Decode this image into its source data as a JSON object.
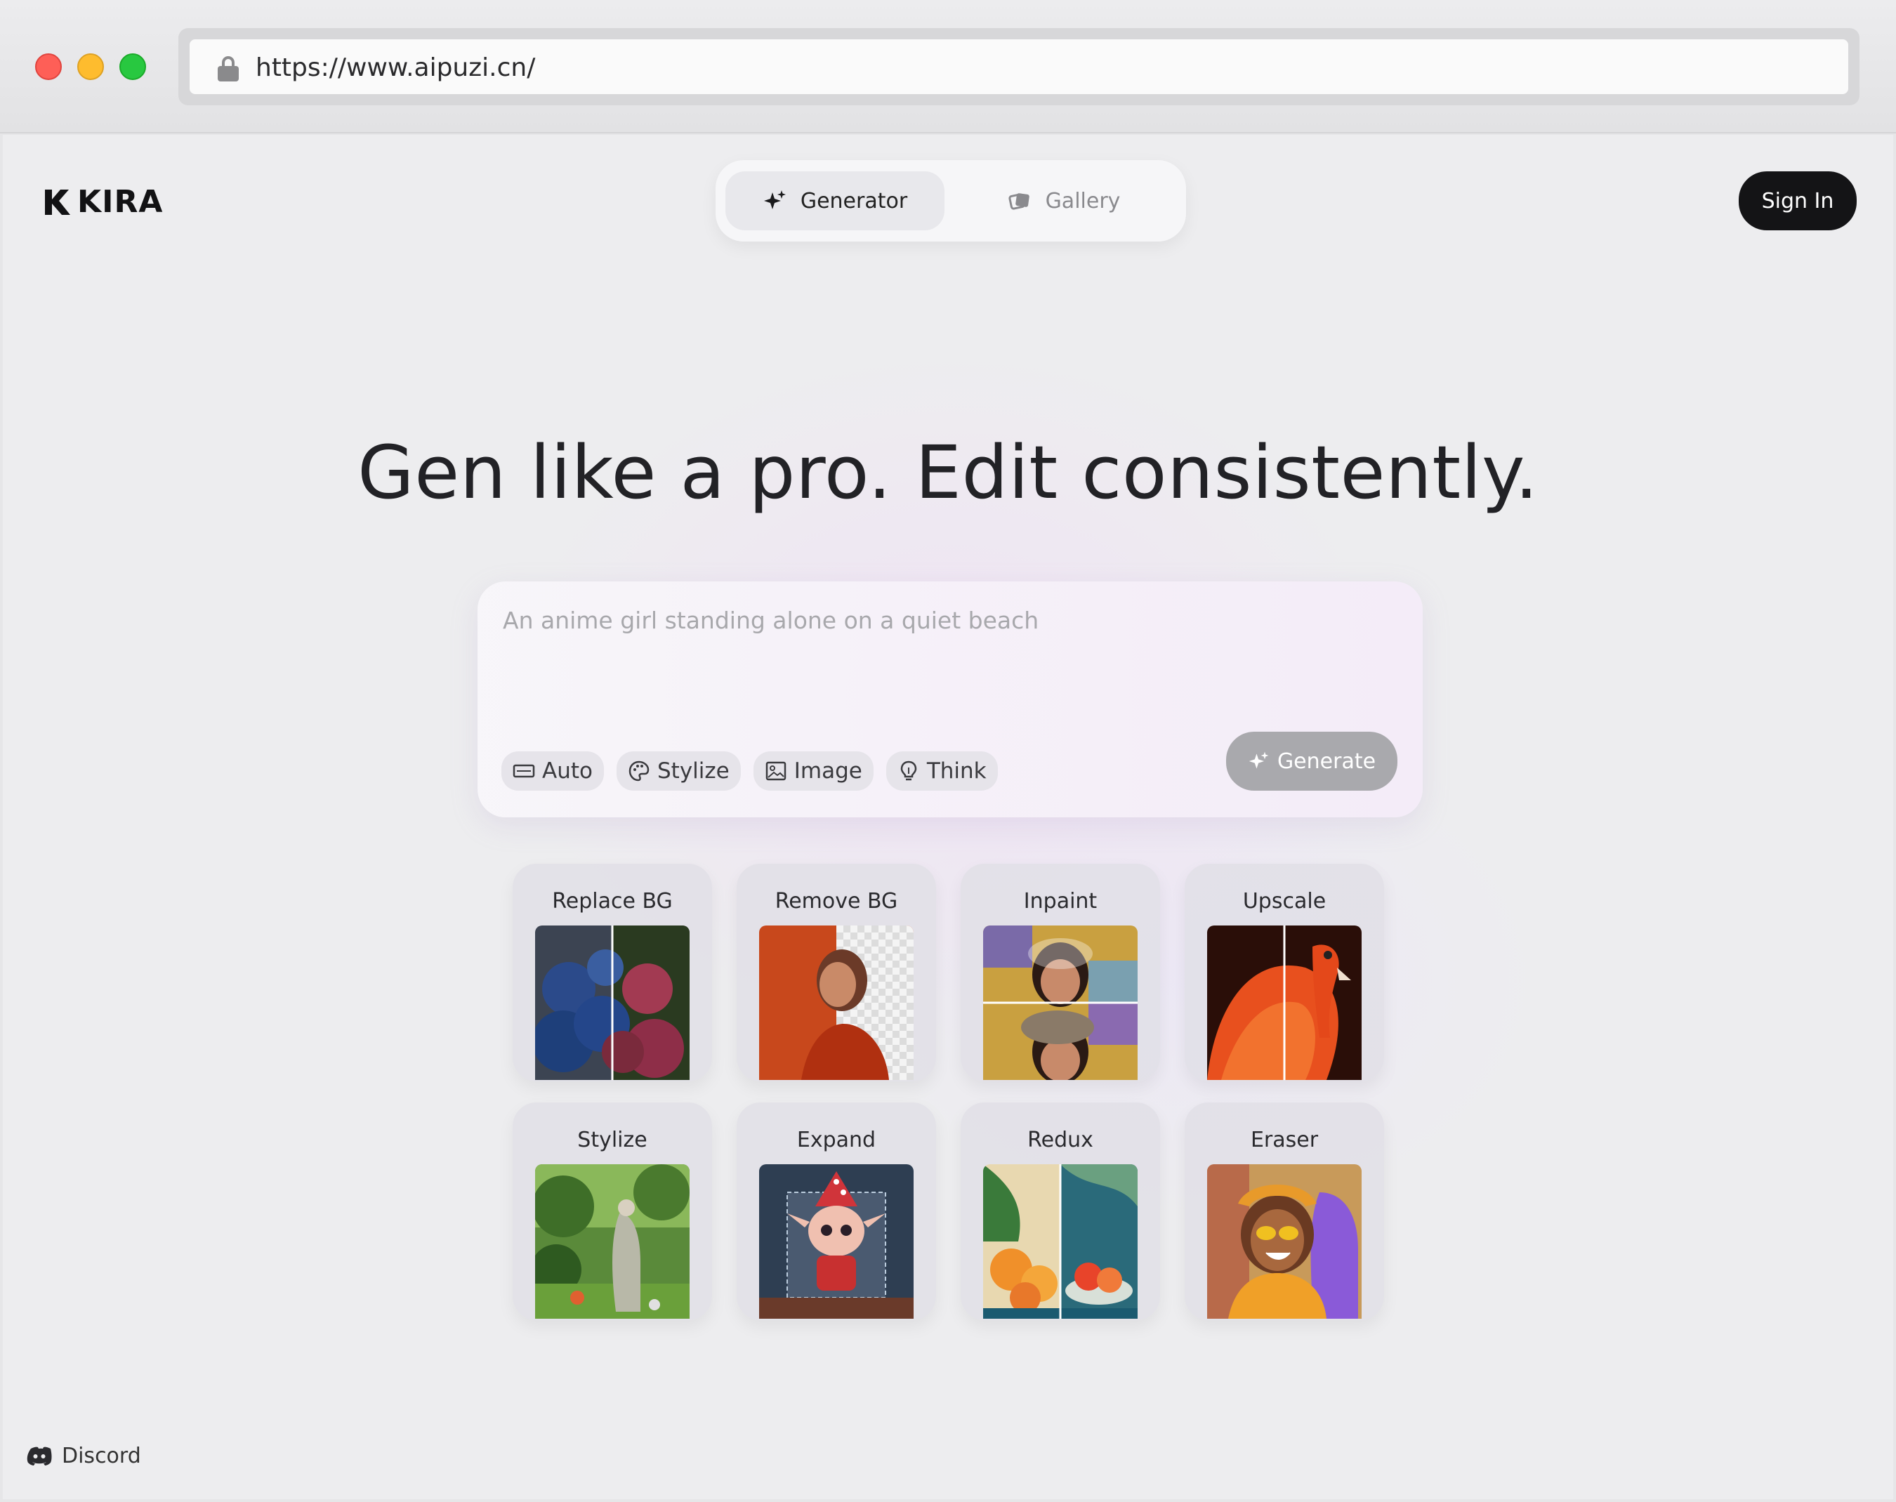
{
  "browser": {
    "url": "https://www.aipuzi.cn/"
  },
  "header": {
    "logo_text": "KIRA",
    "nav": [
      {
        "label": "Generator",
        "icon": "sparkle-icon",
        "active": true
      },
      {
        "label": "Gallery",
        "icon": "gallery-icon",
        "active": false
      }
    ],
    "signin_label": "Sign In"
  },
  "hero": {
    "title": "Gen like a pro. Edit consistently."
  },
  "prompt": {
    "placeholder": "An anime girl standing alone on a quiet beach",
    "chips": [
      {
        "label": "Auto",
        "icon": "aspect-ratio-icon"
      },
      {
        "label": "Stylize",
        "icon": "palette-icon"
      },
      {
        "label": "Image",
        "icon": "image-icon"
      },
      {
        "label": "Think",
        "icon": "lightbulb-icon"
      }
    ],
    "generate_label": "Generate"
  },
  "tools": [
    {
      "label": "Replace BG"
    },
    {
      "label": "Remove BG"
    },
    {
      "label": "Inpaint"
    },
    {
      "label": "Upscale"
    },
    {
      "label": "Stylize"
    },
    {
      "label": "Expand"
    },
    {
      "label": "Redux"
    },
    {
      "label": "Eraser"
    }
  ],
  "footer": {
    "discord_label": "Discord"
  }
}
